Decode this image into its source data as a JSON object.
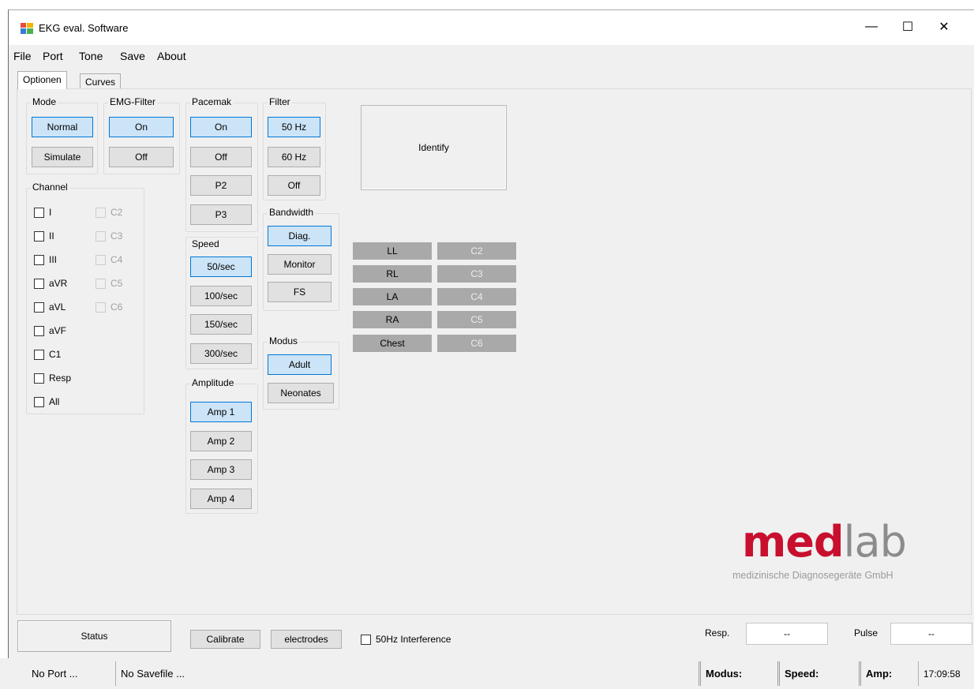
{
  "window": {
    "title": "EKG eval. Software",
    "icon": "app-window-icon",
    "minimize": "—",
    "maximize": "☐",
    "close": "✕"
  },
  "menu": [
    "File",
    "Port",
    "Tone",
    "Save",
    "About"
  ],
  "tabs": [
    "Optionen",
    "Curves"
  ],
  "mode": {
    "label": "Mode",
    "buttons": [
      "Normal",
      "Simulate"
    ],
    "selected": "Normal"
  },
  "emg": {
    "label": "EMG-Filter",
    "buttons": [
      "On",
      "Off"
    ],
    "selected": "On"
  },
  "pacemak": {
    "label": "Pacemak",
    "buttons": [
      "On",
      "Off",
      "P2",
      "P3"
    ],
    "selected": "On"
  },
  "filter": {
    "label": "Filter",
    "buttons": [
      "50 Hz",
      "60 Hz",
      "Off"
    ],
    "selected": "50 Hz"
  },
  "bandwidth": {
    "label": "Bandwidth",
    "buttons": [
      "Diag.",
      "Monitor",
      "FS"
    ],
    "selected": "Diag."
  },
  "speed": {
    "label": "Speed",
    "buttons": [
      "50/sec",
      "100/sec",
      "150/sec",
      "300/sec"
    ],
    "selected": "50/sec"
  },
  "amplitude": {
    "label": "Amplitude",
    "buttons": [
      "Amp 1",
      "Amp 2",
      "Amp 3",
      "Amp 4"
    ],
    "selected": "Amp 1"
  },
  "modus": {
    "label": "Modus",
    "buttons": [
      "Adult",
      "Neonates"
    ],
    "selected": "Adult"
  },
  "channel": {
    "label": "Channel",
    "left": [
      "I",
      "II",
      "III",
      "aVR",
      "aVL",
      "aVF",
      "C1",
      "Resp",
      "All"
    ],
    "right": [
      "C2",
      "C3",
      "C4",
      "C5",
      "C6"
    ]
  },
  "identify": "Identify",
  "electrodes": {
    "left": [
      "LL",
      "RL",
      "LA",
      "RA",
      "Chest"
    ],
    "right": [
      "C2",
      "C3",
      "C4",
      "C5",
      "C6"
    ]
  },
  "logo": {
    "med": "med",
    "lab": "lab",
    "subtitle": "medizinische Diagnosegeräte GmbH",
    "brand_red": "#c8102e",
    "brand_gray": "#8c8c8c"
  },
  "bottom": {
    "status": "Status",
    "calibrate": "Calibrate",
    "electrodes": "electrodes",
    "interference": "50Hz Interference",
    "resp_label": "Resp.",
    "resp_value": "--",
    "pulse_label": "Pulse",
    "pulse_value": "--"
  },
  "statusbar": {
    "port": "No Port ...",
    "savefile": "No Savefile ...",
    "modus": "Modus:",
    "speed": "Speed:",
    "amp": "Amp:",
    "time": "17:09:58"
  },
  "colors": {
    "selected_bg": "#cce4f7",
    "selected_border": "#0078d7",
    "lead_bg": "#a9a9a9"
  }
}
